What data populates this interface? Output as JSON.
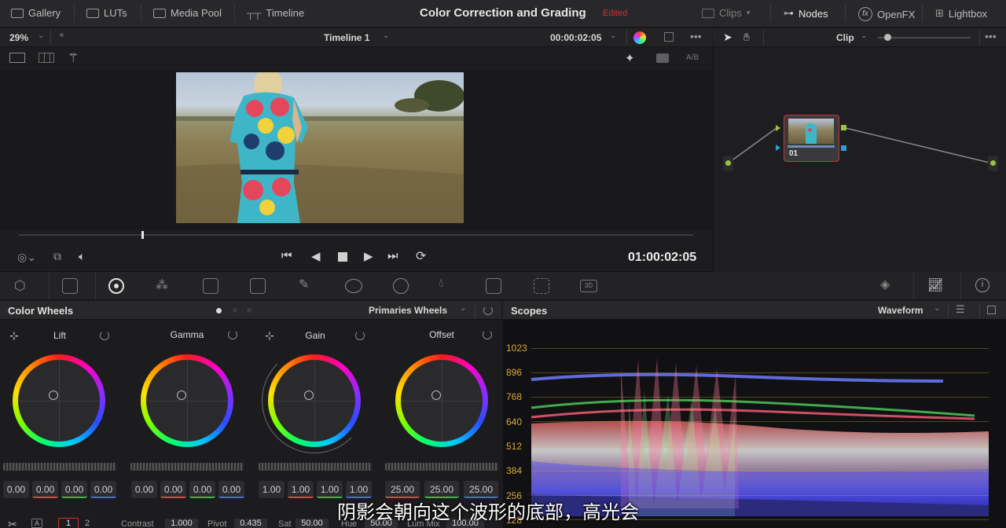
{
  "topbar": {
    "gallery": "Gallery",
    "luts": "LUTs",
    "media_pool": "Media Pool",
    "timeline": "Timeline",
    "title": "Color Correction and Grading",
    "edited": "Edited",
    "clips": "Clips",
    "nodes": "Nodes",
    "openfx": "OpenFX",
    "lightbox": "Lightbox"
  },
  "viewer": {
    "zoom": "29%",
    "timeline_name": "Timeline 1",
    "timecode_top": "00:00:02:05",
    "ab_label": "A/B",
    "timecode": "01:00:02:05"
  },
  "nodes": {
    "mode": "Clip",
    "node_label": "01"
  },
  "color_wheels": {
    "title": "Color Wheels",
    "mode": "Primaries Wheels",
    "wheels": [
      {
        "name": "Lift",
        "values": [
          "0.00",
          "0.00",
          "0.00",
          "0.00"
        ]
      },
      {
        "name": "Gamma",
        "values": [
          "0.00",
          "0.00",
          "0.00",
          "0.00"
        ]
      },
      {
        "name": "Gain",
        "values": [
          "1.00",
          "1.00",
          "1.00",
          "1.00"
        ]
      },
      {
        "name": "Offset",
        "values": [
          "25.00",
          "25.00",
          "25.00"
        ]
      }
    ]
  },
  "scopes": {
    "title": "Scopes",
    "mode": "Waveform",
    "axis": [
      "1023",
      "896",
      "768",
      "640",
      "512",
      "384",
      "256",
      "128"
    ]
  },
  "bottom": {
    "page1": "1",
    "page2": "2",
    "contrast_label": "Contrast",
    "contrast": "1.000",
    "pivot_label": "Pivot",
    "pivot": "0.435",
    "sat_label": "Sat",
    "sat": "50.00",
    "hue_label": "Hue",
    "hue": "50.00",
    "lummix_label": "Lum Mix",
    "lummix": "100.00"
  },
  "subtitle": "阴影会朝向这个波形的底部，高光会",
  "colors": {
    "accent_red": "#c8343a",
    "scope_grid": "#d9a93a",
    "node_green": "#9ac23c",
    "node_blue": "#2aa0d8"
  }
}
